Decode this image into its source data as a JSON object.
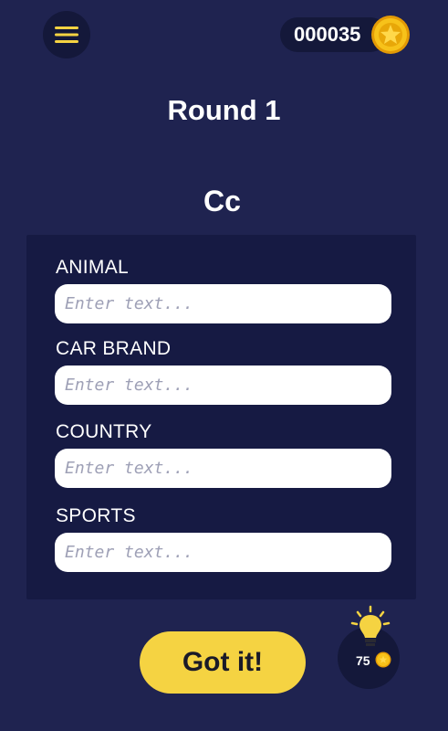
{
  "header": {
    "menu_icon": "hamburger-menu-icon",
    "coin_count": "000035",
    "coin_icon": "gold-star-coin-icon"
  },
  "round": {
    "title": "Round 1"
  },
  "letter": "Cc",
  "categories": [
    {
      "label": "ANIMAL",
      "value": "",
      "placeholder": "Enter text..."
    },
    {
      "label": "CAR BRAND",
      "value": "",
      "placeholder": "Enter text..."
    },
    {
      "label": "COUNTRY",
      "value": "",
      "placeholder": "Enter text..."
    },
    {
      "label": "SPORTS",
      "value": "",
      "placeholder": "Enter text..."
    }
  ],
  "actions": {
    "submit_label": "Got it!",
    "hint_icon": "lightbulb-icon",
    "hint_cost": "75"
  },
  "colors": {
    "background": "#1f2350",
    "panel": "#161a43",
    "button_dark": "#14183a",
    "accent_yellow": "#f5d342",
    "coin_gold": "#f2b705"
  }
}
